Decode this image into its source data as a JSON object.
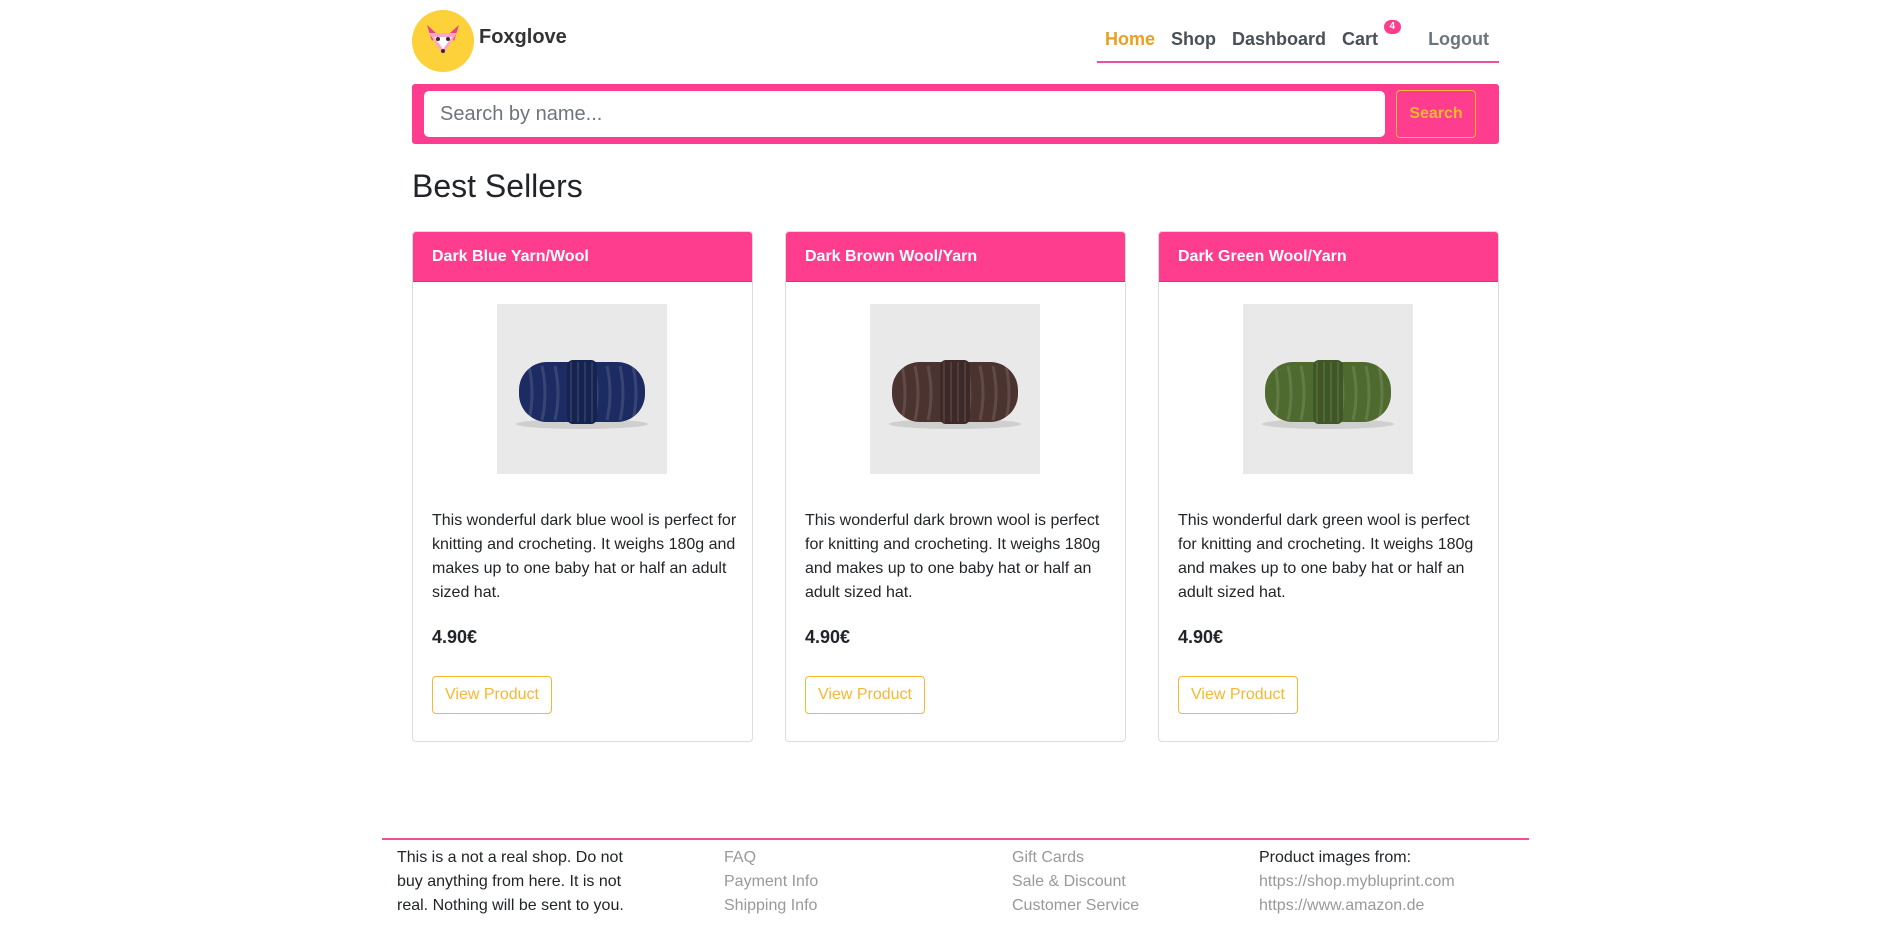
{
  "brand": {
    "name": "Foxglove",
    "logo_icon": "fox-icon"
  },
  "nav": {
    "home": "Home",
    "shop": "Shop",
    "dashboard": "Dashboard",
    "cart": "Cart",
    "cart_count": "4",
    "logout": "Logout"
  },
  "search": {
    "placeholder": "Search by name...",
    "value": "",
    "button": "Search"
  },
  "section_title": "Best Sellers",
  "products": [
    {
      "title": "Dark Blue Yarn/Wool",
      "description": "This wonderful dark blue wool is perfect for knitting and crocheting. It weighs 180g and makes up to one baby hat or half an adult sized hat.",
      "price": "4.90€",
      "button": "View Product",
      "color": "#1c2b62"
    },
    {
      "title": "Dark Brown Wool/Yarn",
      "description": "This wonderful dark brown wool is perfect for knitting and crocheting. It weighs 180g and makes up to one baby hat or half an adult sized hat.",
      "price": "4.90€",
      "button": "View Product",
      "color": "#4b3330"
    },
    {
      "title": "Dark Green Wool/Yarn",
      "description": "This wonderful dark green wool is perfect for knitting and crocheting. It weighs 180g and makes up to one baby hat or half an adult sized hat.",
      "price": "4.90€",
      "button": "View Product",
      "color": "#4e6a2e"
    }
  ],
  "footer": {
    "disclaimer": [
      "This is a not a real shop. Do not",
      "buy anything from here. It is not",
      "real. Nothing will be sent to you."
    ],
    "links1": [
      "FAQ",
      "Payment Info",
      "Shipping Info"
    ],
    "links2": [
      "Gift Cards",
      "Sale & Discount",
      "Customer Service"
    ],
    "credits_title": "Product images from:",
    "credits": [
      "https://shop.mybluprint.com",
      "https://www.amazon.de"
    ]
  },
  "colors": {
    "accent_pink": "#ff3d8e",
    "accent_yellow": "#f7b731",
    "nav_active": "#e8a020"
  }
}
